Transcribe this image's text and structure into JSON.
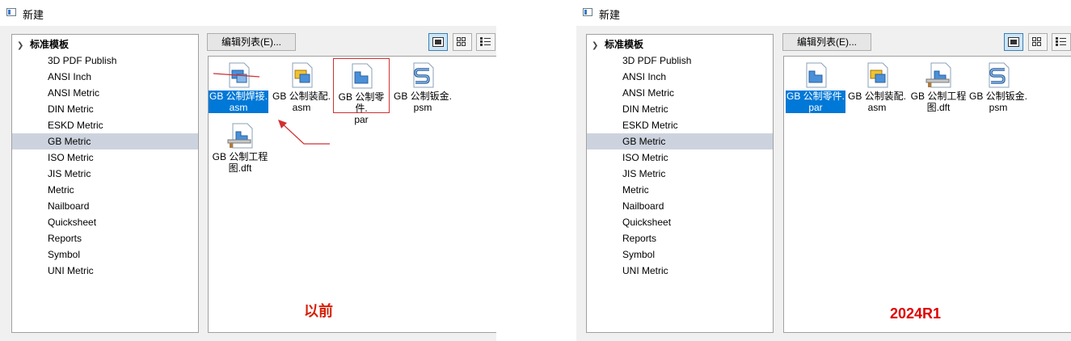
{
  "left": {
    "window_title": "新建",
    "tree_root": "标准模板",
    "tree_items": [
      "3D PDF Publish",
      "ANSI Inch",
      "ANSI Metric",
      "DIN Metric",
      "ESKD Metric",
      "GB Metric",
      "ISO Metric",
      "JIS Metric",
      "Metric",
      "Nailboard",
      "Quicksheet",
      "Reports",
      "Symbol",
      "UNI Metric"
    ],
    "selected_tree_item": "GB Metric",
    "edit_list_button": "编辑列表(E)...",
    "files": [
      {
        "line1": "GB 公制焊接.",
        "line2": "asm",
        "icon": "weldment-assembly-icon",
        "selected": true
      },
      {
        "line1": "GB 公制装配.",
        "line2": "asm",
        "icon": "assembly-icon",
        "selected": false
      },
      {
        "line1": "GB 公制零件.",
        "line2": "par",
        "icon": "part-icon",
        "selected": false
      },
      {
        "line1": "GB 公制钣金.",
        "line2": "psm",
        "icon": "sheet-metal-icon",
        "selected": false
      },
      {
        "line1": "GB 公制工程",
        "line2": "图.dft",
        "icon": "drawing-icon",
        "selected": false
      }
    ],
    "annotation": "以前",
    "annotation_color": "#d81e06"
  },
  "right": {
    "window_title": "新建",
    "tree_root": "标准模板",
    "tree_items": [
      "3D PDF Publish",
      "ANSI Inch",
      "ANSI Metric",
      "DIN Metric",
      "ESKD Metric",
      "GB Metric",
      "ISO Metric",
      "JIS Metric",
      "Metric",
      "Nailboard",
      "Quicksheet",
      "Reports",
      "Symbol",
      "UNI Metric"
    ],
    "selected_tree_item": "GB Metric",
    "edit_list_button": "编辑列表(E)...",
    "files": [
      {
        "line1": "GB 公制零件.",
        "line2": "par",
        "icon": "part-icon",
        "selected": true
      },
      {
        "line1": "GB 公制装配.",
        "line2": "asm",
        "icon": "assembly-icon",
        "selected": false
      },
      {
        "line1": "GB 公制工程",
        "line2": "图.dft",
        "icon": "drawing-icon",
        "selected": false
      },
      {
        "line1": "GB 公制钣金.",
        "line2": "psm",
        "icon": "sheet-metal-icon",
        "selected": false
      }
    ],
    "annotation": "2024R1",
    "annotation_color": "#e00000"
  },
  "colors": {
    "selection": "#0078d7",
    "tree_selection": "#cdd3de",
    "active_view_button": "#cde6f7"
  }
}
